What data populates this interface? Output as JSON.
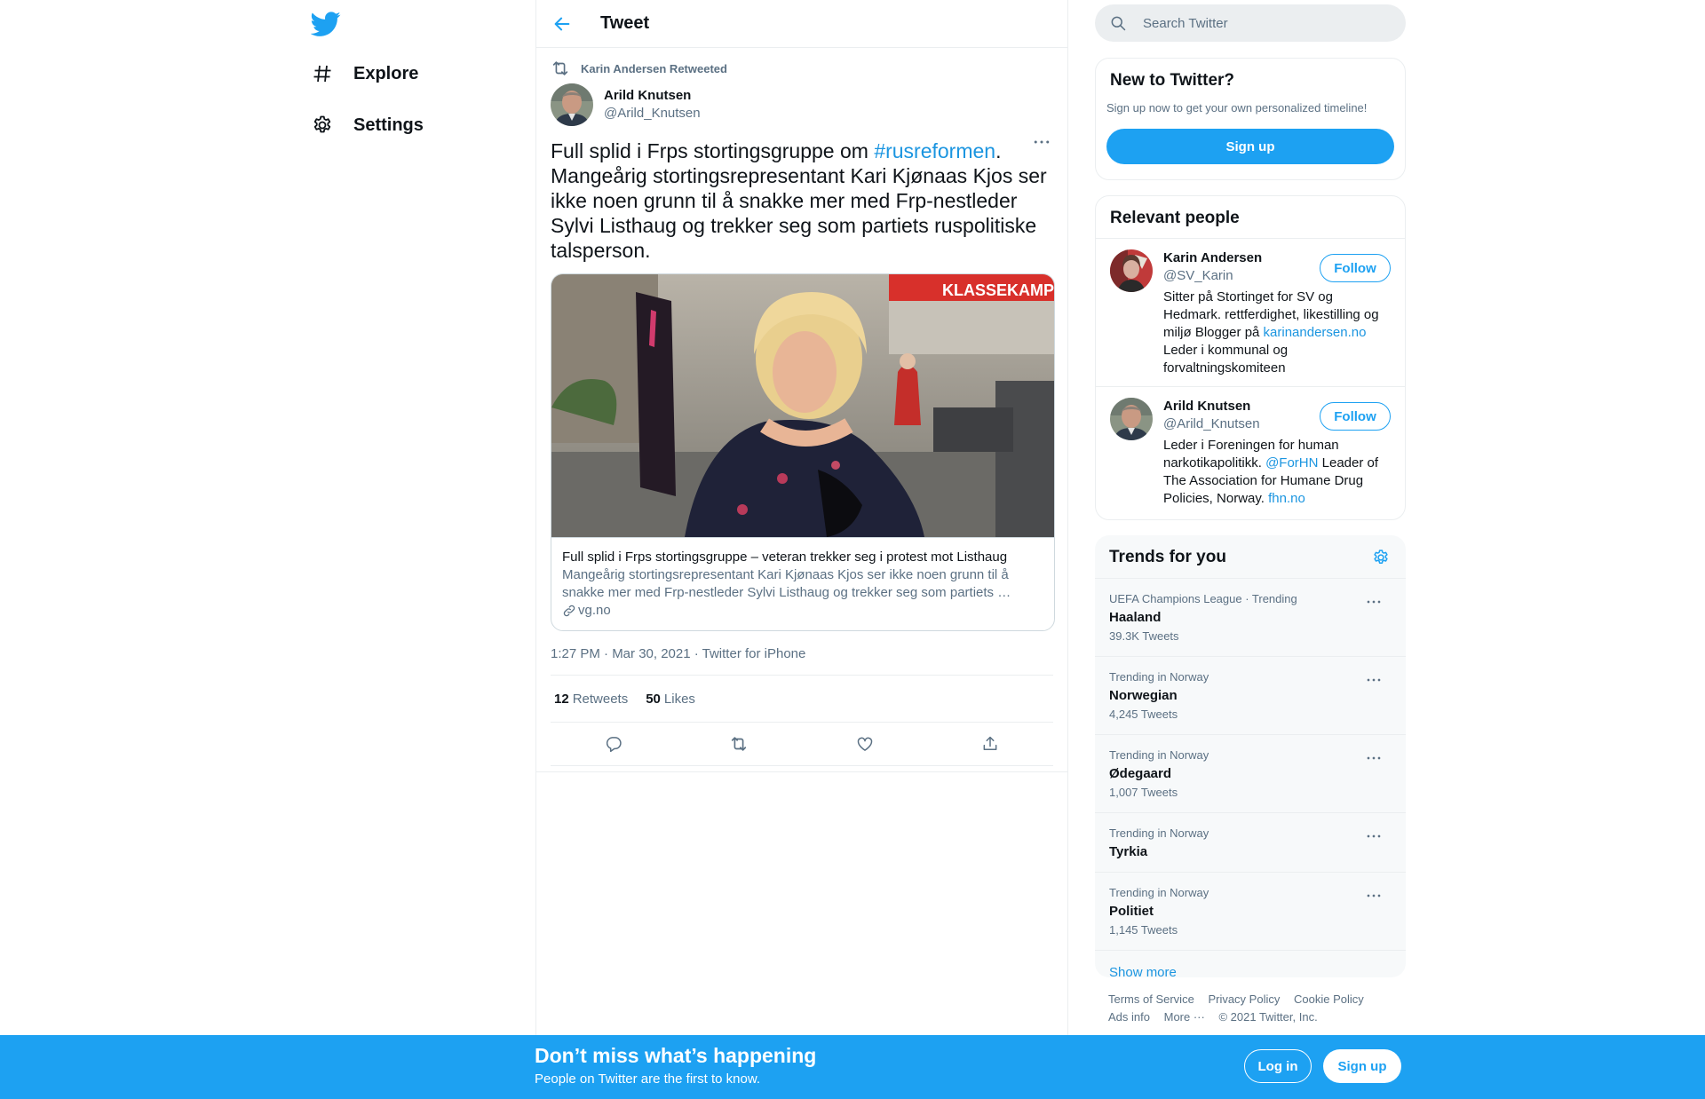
{
  "nav": {
    "logo_icon": "twitter-bird-icon",
    "items": [
      {
        "label": "Explore",
        "icon": "hashtag-icon"
      },
      {
        "label": "Settings",
        "icon": "gear-icon"
      }
    ]
  },
  "header": {
    "title": "Tweet",
    "back_icon": "arrow-left-icon"
  },
  "tweet": {
    "retweeted_by": "Karin Andersen Retweeted",
    "author_name": "Arild Knutsen",
    "author_handle": "@Arild_Knutsen",
    "text_before": "Full splid i Frps stortingsgruppe om ",
    "hashtag": "#rusreformen",
    "text_after": ". Mangeårig stortingsrepresentant Kari Kjønaas Kjos ser ikke noen grunn til å snakke mer med Frp-nestleder Sylvi Listhaug og trekker seg som partiets ruspolitiske talsperson.",
    "card": {
      "title": "Full splid i Frps stortingsgruppe – veteran trekker seg i protest mot Listhaug",
      "description": "Mangeårig stortingsrepresentant Kari Kjønaas Kjos ser ikke noen grunn til å snakke mer med Frp-nestleder Sylvi Listhaug og trekker seg som partiets …",
      "domain": "vg.no",
      "image_banner_text": "KLASSEKAMPEN"
    },
    "timestamp": "1:27 PM · Mar 30, 2021 · Twitter for iPhone",
    "retweets_count": "12",
    "retweets_label": "Retweets",
    "likes_count": "50",
    "likes_label": "Likes"
  },
  "search": {
    "placeholder": "Search Twitter"
  },
  "new_to_twitter": {
    "title": "New to Twitter?",
    "subtitle": "Sign up now to get your own personalized timeline!",
    "button": "Sign up"
  },
  "relevant_people": {
    "title": "Relevant people",
    "follow_label": "Follow",
    "people": [
      {
        "name": "Karin Andersen",
        "handle": "@SV_Karin",
        "bio_before": "Sitter på Stortinget for SV og Hedmark. rettferdighet, likestilling og miljø Blogger på ",
        "bio_link": "karinandersen.no",
        "bio_after": " Leder i kommunal og forvaltningskomiteen"
      },
      {
        "name": "Arild Knutsen",
        "handle": "@Arild_Knutsen",
        "bio_before": "Leder i Foreningen for human narkotikapolitikk. ",
        "bio_link": "@ForHN",
        "bio_middle": " Leader of The Association for Humane Drug Policies, Norway. ",
        "bio_link2": "fhn.no"
      }
    ]
  },
  "trends": {
    "title": "Trends for you",
    "items": [
      {
        "meta": "UEFA Champions League · Trending",
        "name": "Haaland",
        "count": "39.3K Tweets"
      },
      {
        "meta": "Trending in Norway",
        "name": "Norwegian",
        "count": "4,245 Tweets"
      },
      {
        "meta": "Trending in Norway",
        "name": "Ødegaard",
        "count": "1,007 Tweets"
      },
      {
        "meta": "Trending in Norway",
        "name": "Tyrkia",
        "count": ""
      },
      {
        "meta": "Trending in Norway",
        "name": "Politiet",
        "count": "1,145 Tweets"
      }
    ],
    "show_more": "Show more"
  },
  "footer": {
    "links": [
      "Terms of Service",
      "Privacy Policy",
      "Cookie Policy",
      "Ads info",
      "More ···"
    ],
    "copyright": "© 2021 Twitter, Inc."
  },
  "bottom_bar": {
    "title": "Don’t miss what’s happening",
    "subtitle": "People on Twitter are the first to know.",
    "login": "Log in",
    "signup": "Sign up"
  },
  "colors": {
    "accent": "#1da1f2",
    "link": "#1b95e0",
    "secondary_text": "#5b7083",
    "border": "#ebeef0"
  }
}
